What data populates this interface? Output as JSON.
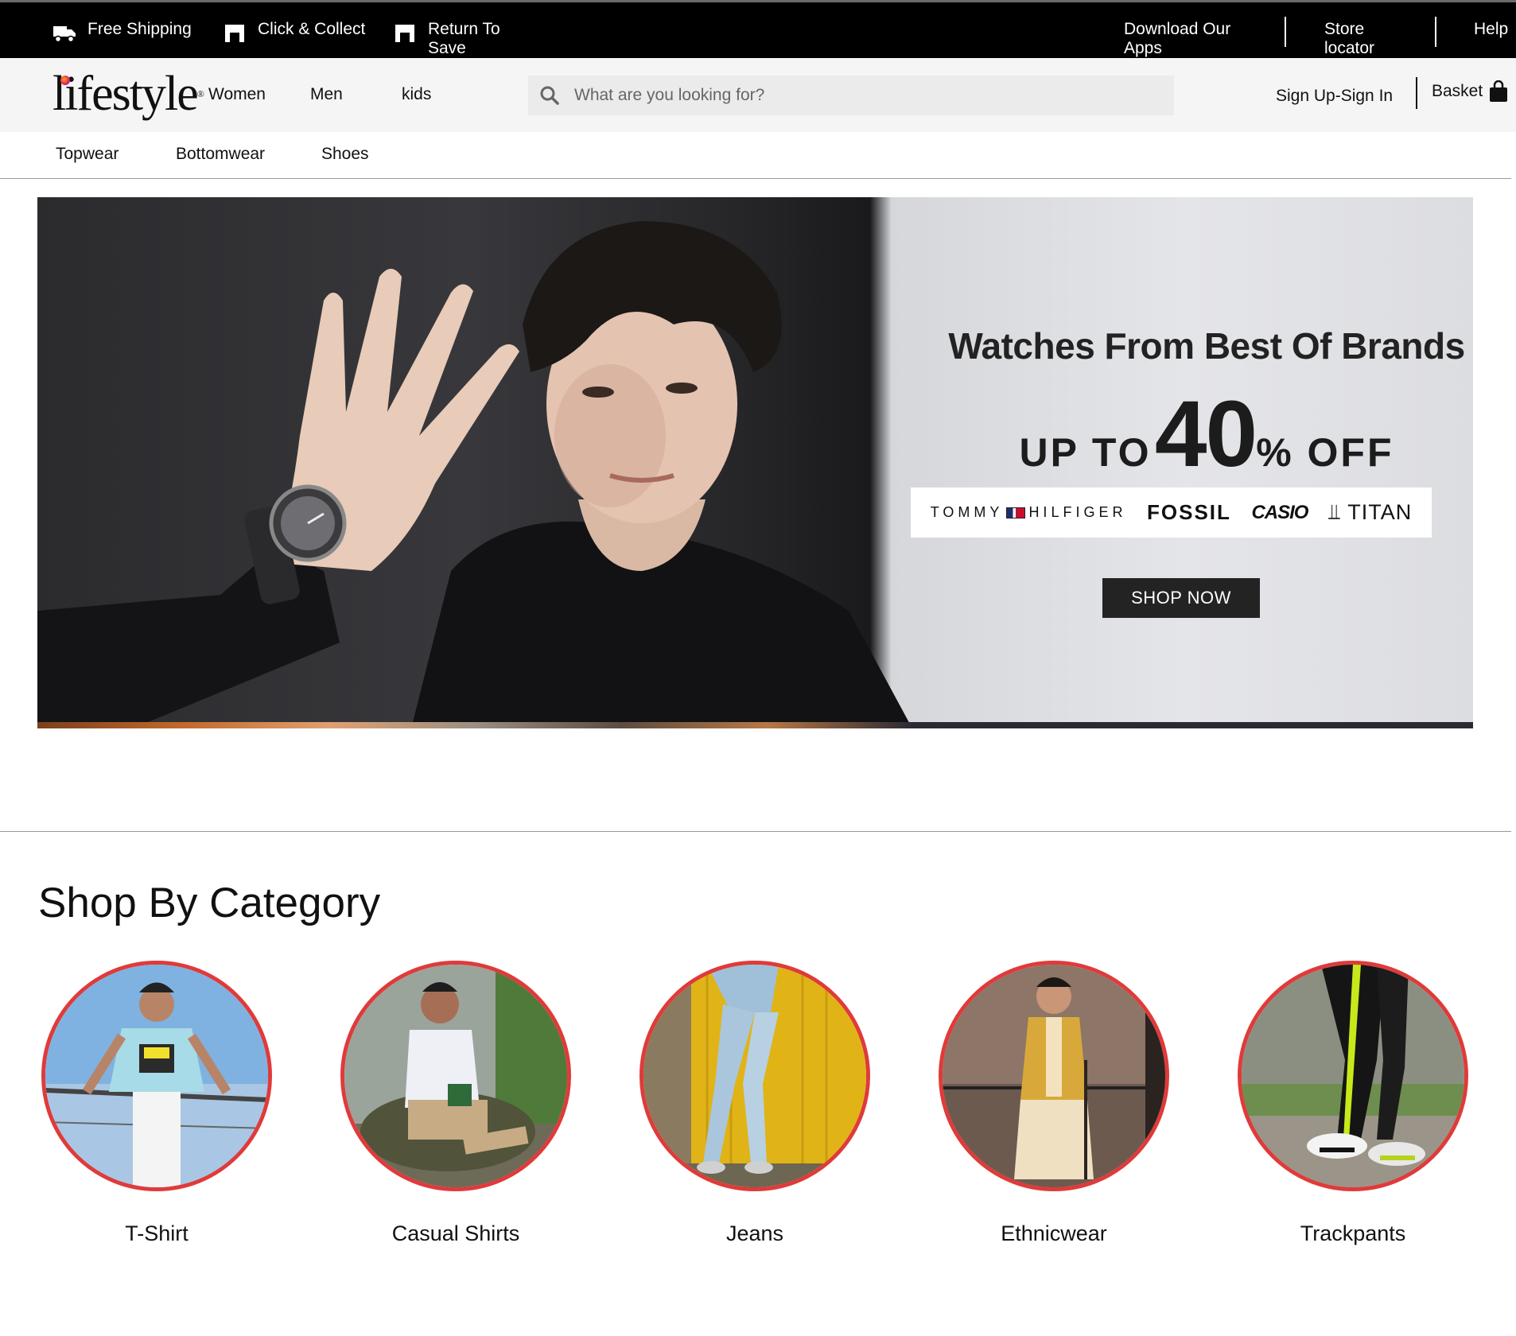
{
  "topbar": {
    "free_shipping": "Free Shipping",
    "click_collect": "Click & Collect",
    "return_save": "Return To Save",
    "download_apps": "Download Our Apps",
    "store_locator": "Store locator",
    "help": "Help"
  },
  "header": {
    "logo": "lifestyle",
    "nav": [
      "Women",
      "Men",
      "kids"
    ],
    "search_placeholder": "What are you looking for?",
    "signin": "Sign Up-Sign In",
    "basket": "Basket"
  },
  "subnav": [
    "Topwear",
    "Bottomwear",
    "Shoes"
  ],
  "hero": {
    "title": "Watches From Best Of Brands",
    "up_to": "UP TO",
    "percent": "40",
    "off": "% OFF",
    "brands": [
      "TOMMY",
      "HILFIGER",
      "FOSSIL",
      "CASIO",
      "TITAN"
    ],
    "cta": "SHOP NOW"
  },
  "categories": {
    "title": "Shop By Category",
    "items": [
      "T-Shirt",
      "Casual Shirts",
      "Jeans",
      "Ethnicwear",
      "Trackpants"
    ]
  },
  "colors": {
    "topbar_bg": "#000000",
    "header_bg": "#f5f5f5",
    "category_ring": "#e03a3a",
    "cta_bg": "#232323"
  }
}
